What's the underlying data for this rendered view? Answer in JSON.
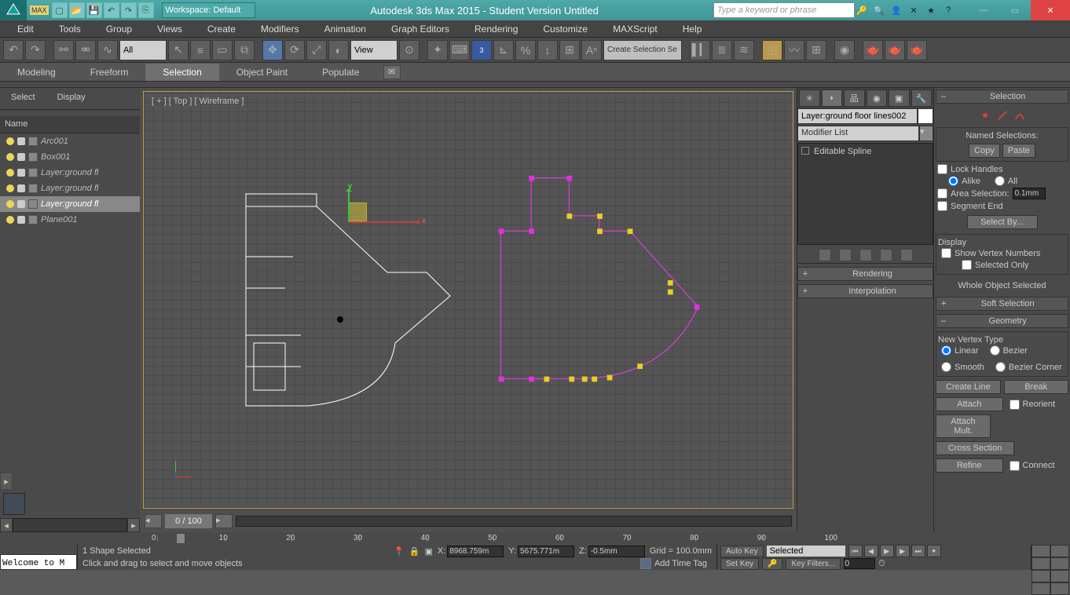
{
  "title": "Autodesk 3ds Max  2015  - Student Version    Untitled",
  "workspace_label": "Workspace: Default",
  "search_placeholder": "Type a keyword or phrase",
  "menu": [
    "Edit",
    "Tools",
    "Group",
    "Views",
    "Create",
    "Modifiers",
    "Animation",
    "Graph Editors",
    "Rendering",
    "Customize",
    "MAXScript",
    "Help"
  ],
  "toolbar_dropdowns": {
    "filter": "All",
    "refcoord": "View",
    "namedsel": "Create Selection Se"
  },
  "ribbon_tabs": [
    "Modeling",
    "Freeform",
    "Selection",
    "Object Paint",
    "Populate"
  ],
  "left_tabs": [
    "Select",
    "Display"
  ],
  "scene_header": "Name",
  "scene_items": [
    {
      "label": "Arc001"
    },
    {
      "label": "Box001"
    },
    {
      "label": "Layer:ground fl"
    },
    {
      "label": "Layer:ground fl"
    },
    {
      "label": "Layer:ground fl",
      "sel": true
    },
    {
      "label": "Plane001"
    }
  ],
  "viewport_label": "[ + ] [ Top ] [ Wireframe ]",
  "slider_page": "0 / 100",
  "command_panel": {
    "layer_name": "Layer:ground floor lines002",
    "modifier_list": "Modifier List",
    "stack_item": "Editable Spline",
    "rollouts": [
      "Rendering",
      "Interpolation"
    ]
  },
  "sel_panel": {
    "title": "Selection",
    "named": "Named Selections:",
    "copy": "Copy",
    "paste": "Paste",
    "lock": "Lock Handles",
    "alike": "Alike",
    "all": "All",
    "area": "Area Selection:",
    "area_val": "0.1mm",
    "segend": "Segment End",
    "selectby": "Select By...",
    "display": "Display",
    "showvn": "Show Vertex Numbers",
    "selonly": "Selected Only",
    "whole": "Whole Object Selected",
    "soft": "Soft Selection",
    "geom": "Geometry",
    "nvt": "New Vertex Type",
    "linear": "Linear",
    "bezier": "Bezier",
    "smooth": "Smooth",
    "bezc": "Bezier Corner",
    "cline": "Create Line",
    "break": "Break",
    "attach": "Attach",
    "attachm": "Attach Mult.",
    "reorient": "Reorient",
    "cross": "Cross Section",
    "refine": "Refine",
    "connect": "Connect"
  },
  "timeline_ticks": [
    "0",
    "10",
    "20",
    "30",
    "40",
    "50",
    "60",
    "70",
    "80",
    "90",
    "100"
  ],
  "status": {
    "script": "Welcome to M",
    "sel": "1 Shape Selected",
    "hint": "Click and drag to select and move objects",
    "x": "8968.759m",
    "y": "5675.771m",
    "z": "-0.5mm",
    "grid": "Grid = 100.0mm",
    "autokey": "Auto Key",
    "setkey": "Set Key",
    "seldrop": "Selected",
    "keyfilters": "Key Filters...",
    "addtag": "Add Time Tag"
  }
}
